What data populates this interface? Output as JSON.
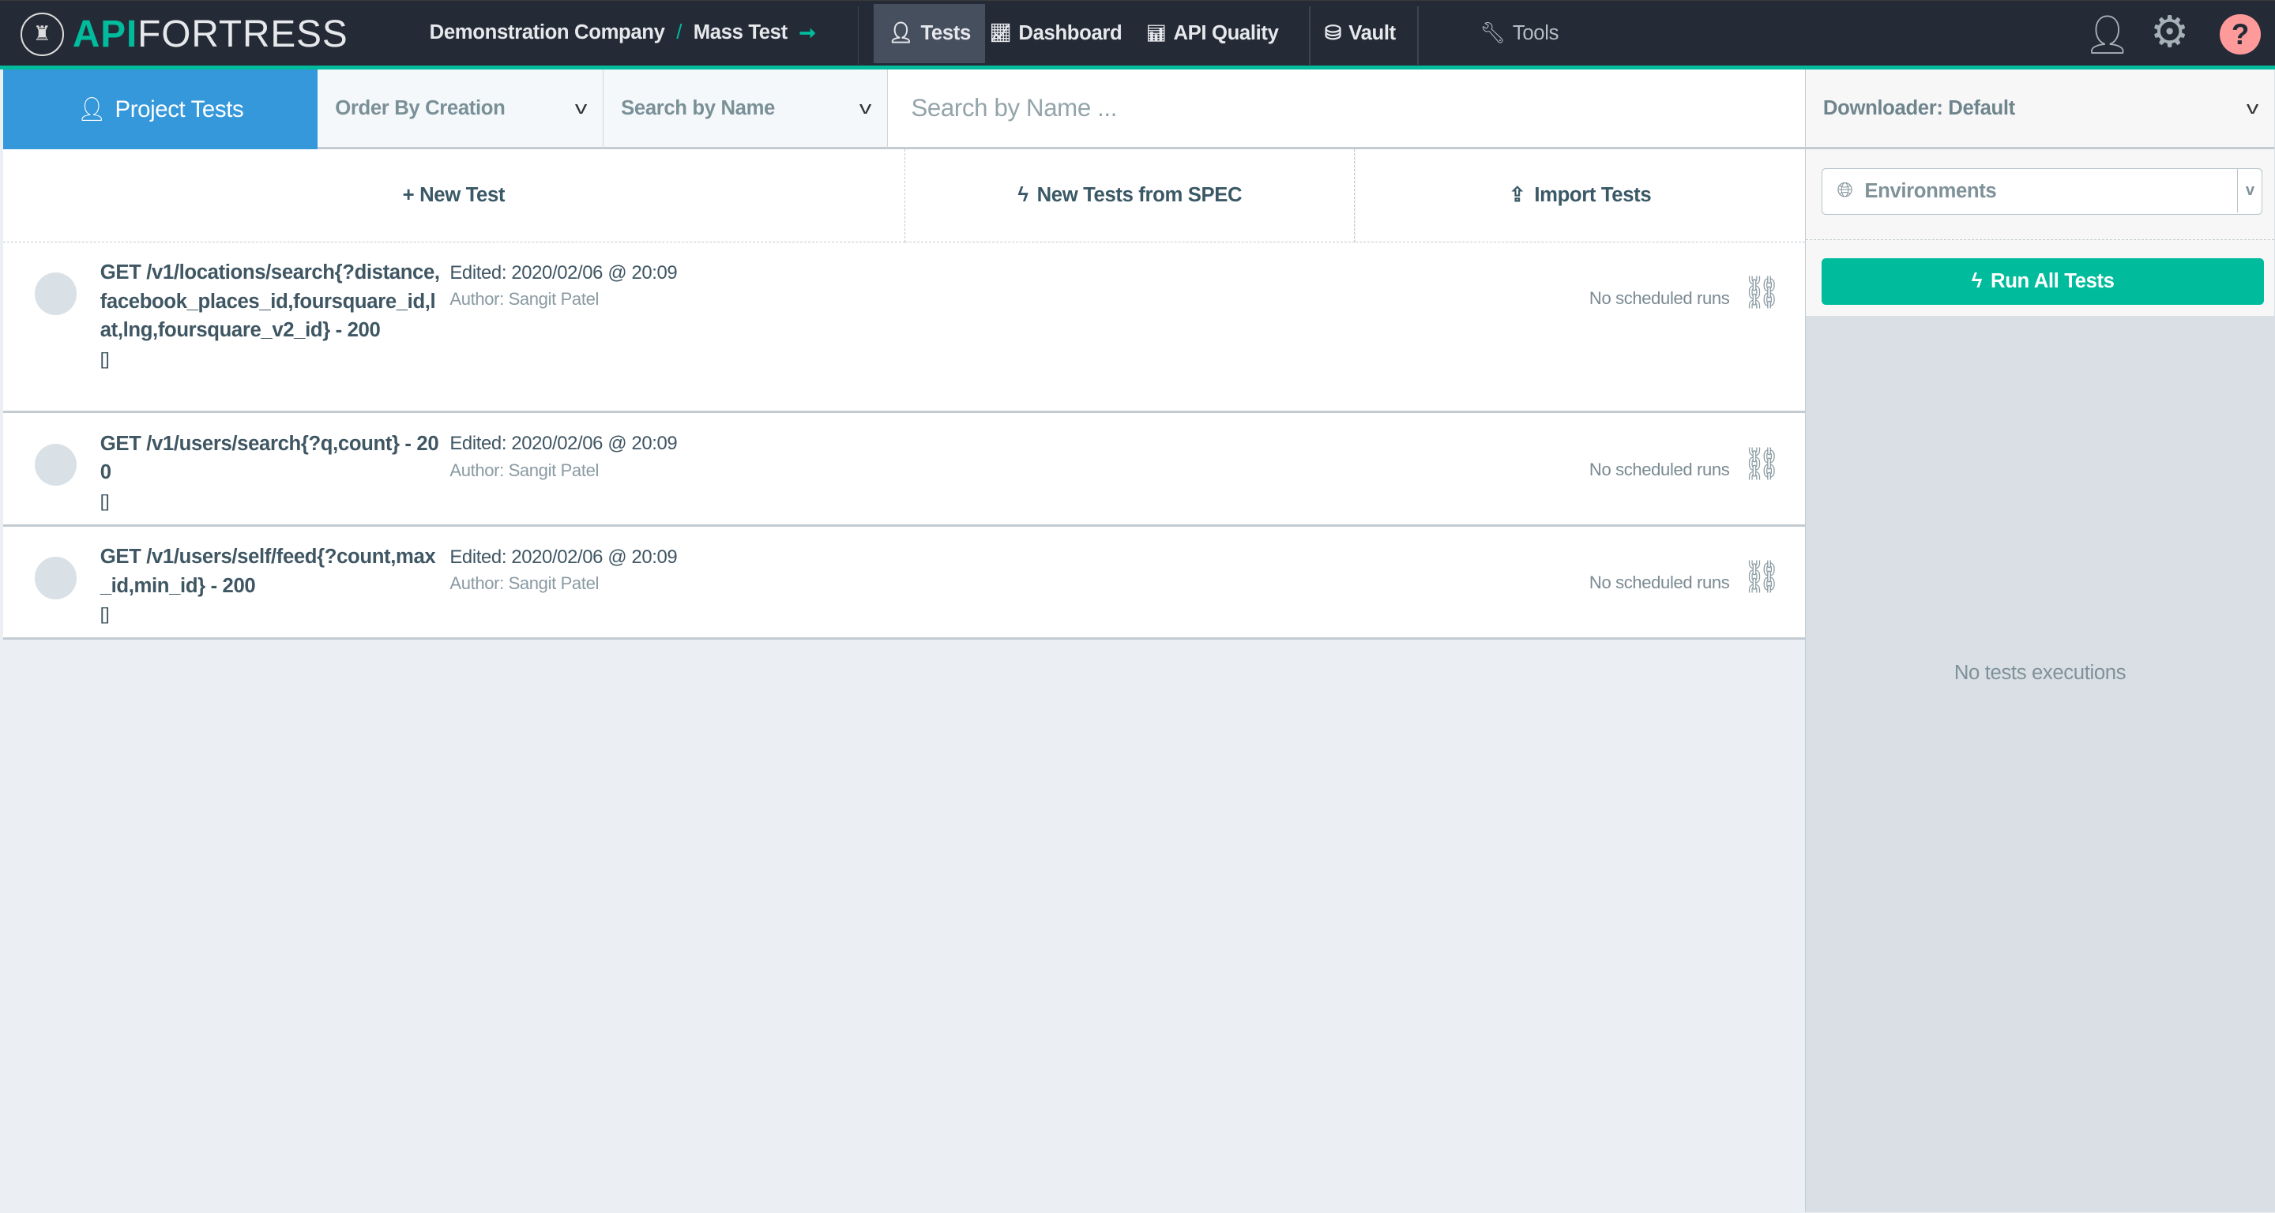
{
  "header": {
    "logo": {
      "api": "API",
      "fortress": "FORTRESS"
    },
    "breadcrumb": {
      "company": "Demonstration Company",
      "separator": "/",
      "project": "Mass Test"
    },
    "nav": [
      {
        "label": "Tests",
        "icon": "tests-icon",
        "active": true
      },
      {
        "label": "Dashboard",
        "icon": "chart-line-icon"
      },
      {
        "label": "API Quality",
        "icon": "bar-chart-icon"
      },
      {
        "label": "Vault",
        "icon": "database-icon"
      },
      {
        "label": "Tools",
        "icon": "wrench-icon"
      }
    ]
  },
  "toolbar": {
    "project_tests": "Project Tests",
    "order_by": "Order By Creation",
    "search_by": "Search by Name",
    "search_placeholder": "Search by Name ..."
  },
  "actions": {
    "new_test": "+ New Test",
    "new_from_spec": "New Tests from SPEC",
    "import": "Import Tests"
  },
  "tests": [
    {
      "title": "GET /v1/locations/search{?distance,facebook_places_id,foursquare_id,lat,lng,foursquare_v2_id} - 200",
      "tags": "[]",
      "edited": "Edited: 2020/02/06 @ 20:09",
      "author": "Author: Sangit Patel",
      "schedule": "No scheduled runs"
    },
    {
      "title": "GET /v1/users/search{?q,count} - 200",
      "tags": "[]",
      "edited": "Edited: 2020/02/06 @ 20:09",
      "author": "Author: Sangit Patel",
      "schedule": "No scheduled runs"
    },
    {
      "title": "GET /v1/users/self/feed{?count,max_id,min_id} - 200",
      "tags": "[]",
      "edited": "Edited: 2020/02/06 @ 20:09",
      "author": "Author: Sangit Patel",
      "schedule": "No scheduled runs"
    }
  ],
  "right_panel": {
    "downloader": "Downloader: Default",
    "environments": "Environments",
    "run_all": "Run All Tests",
    "no_executions": "No tests executions"
  },
  "colors": {
    "header": "#252b36",
    "accent": "#00bc9c",
    "primary": "#3498db",
    "help": "#ff9a9a"
  }
}
